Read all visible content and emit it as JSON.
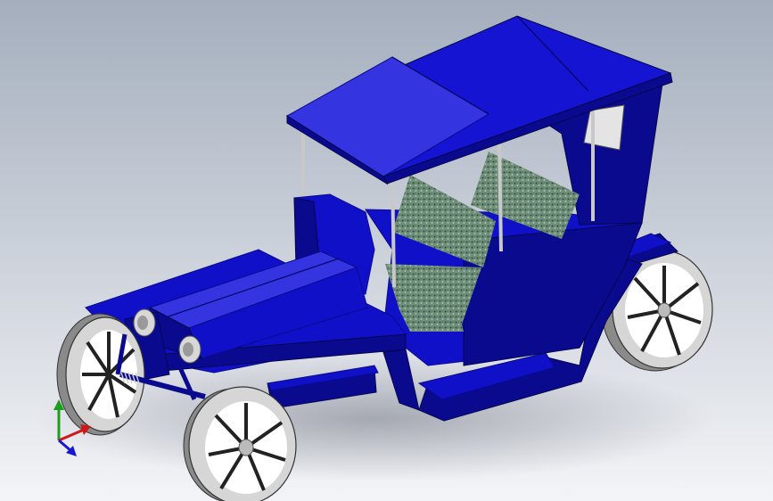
{
  "viewport": {
    "background_top": "#a4aebd",
    "background_bottom": "#f3f4f7"
  },
  "model": {
    "body_color": "#1010c8",
    "body_dark": "#0a0a8e",
    "body_light": "#3434e0",
    "roof_color": "#1414d2",
    "post_color": "#c8c8c8",
    "tire_color": "#d6d6d6",
    "tire_shadow": "#8a8a8a",
    "seat_color": "#6f8f7a",
    "lamp_color": "#d8d8d8",
    "window_color": "#e4e4e4"
  },
  "triad": {
    "x_axis_color": "#d01818",
    "y_axis_color": "#18a018",
    "z_axis_color": "#1818d0",
    "x_icon": "axis-x-arrow",
    "y_icon": "axis-y-arrow",
    "z_icon": "axis-z-arrow"
  }
}
